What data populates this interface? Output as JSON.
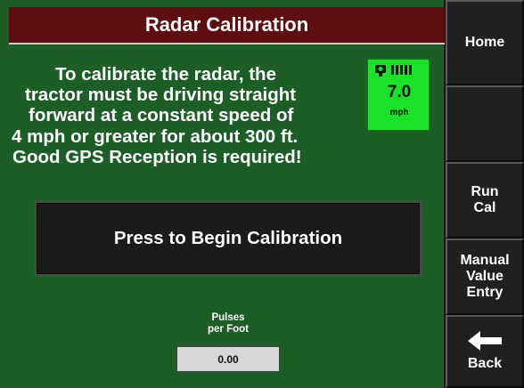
{
  "title": "Radar Calibration",
  "instructions": [
    "To calibrate the radar, the",
    "tractor must be driving straight",
    "forward at a constant speed of",
    "4 mph or greater for about 300 ft.",
    "Good GPS Reception is required!"
  ],
  "speed": {
    "value": "7.0",
    "unit": "mph",
    "icon": "gps-signal-icon",
    "background": "#19e327"
  },
  "begin_button_label": "Press to Begin Calibration",
  "pulses": {
    "label_line1": "Pulses",
    "label_line2": "per Foot",
    "value": "0.00"
  },
  "sidebar": {
    "home": "Home",
    "blank": "",
    "run_cal": [
      "Run",
      "Cal"
    ],
    "manual_entry": [
      "Manual",
      "Value",
      "Entry"
    ],
    "back": {
      "label": "Back",
      "icon": "left-arrow-icon"
    }
  },
  "colors": {
    "panel": "#1c5e26",
    "title_bar": "#5e0e0e",
    "button": "#1b1b1b"
  }
}
